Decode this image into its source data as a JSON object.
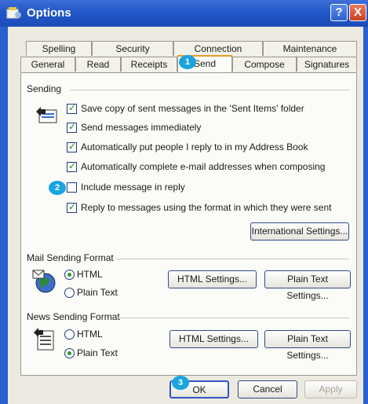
{
  "window": {
    "title": "Options",
    "help_glyph": "?",
    "close_glyph": "X"
  },
  "tabs": {
    "row1": [
      "Spelling",
      "Security",
      "Connection",
      "Maintenance"
    ],
    "row2": [
      "General",
      "Read",
      "Receipts",
      "Send",
      "Compose",
      "Signatures"
    ],
    "active": "Send"
  },
  "sending": {
    "label": "Sending",
    "options": [
      {
        "label": "Save copy of sent messages in the 'Sent Items' folder",
        "checked": true
      },
      {
        "label": "Send messages immediately",
        "checked": true
      },
      {
        "label": "Automatically put people I reply to in my Address Book",
        "checked": true
      },
      {
        "label": "Automatically complete e-mail addresses when composing",
        "checked": true
      },
      {
        "label": "Include message in reply",
        "checked": false
      },
      {
        "label": "Reply to messages using the format in which they were sent",
        "checked": true
      }
    ],
    "international_button": "International Settings..."
  },
  "mail_format": {
    "label": "Mail Sending Format",
    "html_label": "HTML",
    "plain_label": "Plain Text",
    "selected": "HTML",
    "html_settings_button": "HTML Settings...",
    "plain_settings_button": "Plain Text Settings..."
  },
  "news_format": {
    "label": "News Sending Format",
    "html_label": "HTML",
    "plain_label": "Plain Text",
    "selected": "Plain Text",
    "html_settings_button": "HTML Settings...",
    "plain_settings_button": "Plain Text Settings..."
  },
  "footer": {
    "ok": "OK",
    "cancel": "Cancel",
    "apply": "Apply"
  },
  "callouts": {
    "one": "1",
    "two": "2",
    "three": "3"
  },
  "colors": {
    "titlebar": "#2257c9",
    "callout": "#1aa4e0",
    "check": "#1a8b1a"
  },
  "icons": {
    "app": "options-app-icon",
    "sending": "outbox-tray-icon",
    "mail": "globe-mail-icon",
    "news": "news-document-icon"
  }
}
